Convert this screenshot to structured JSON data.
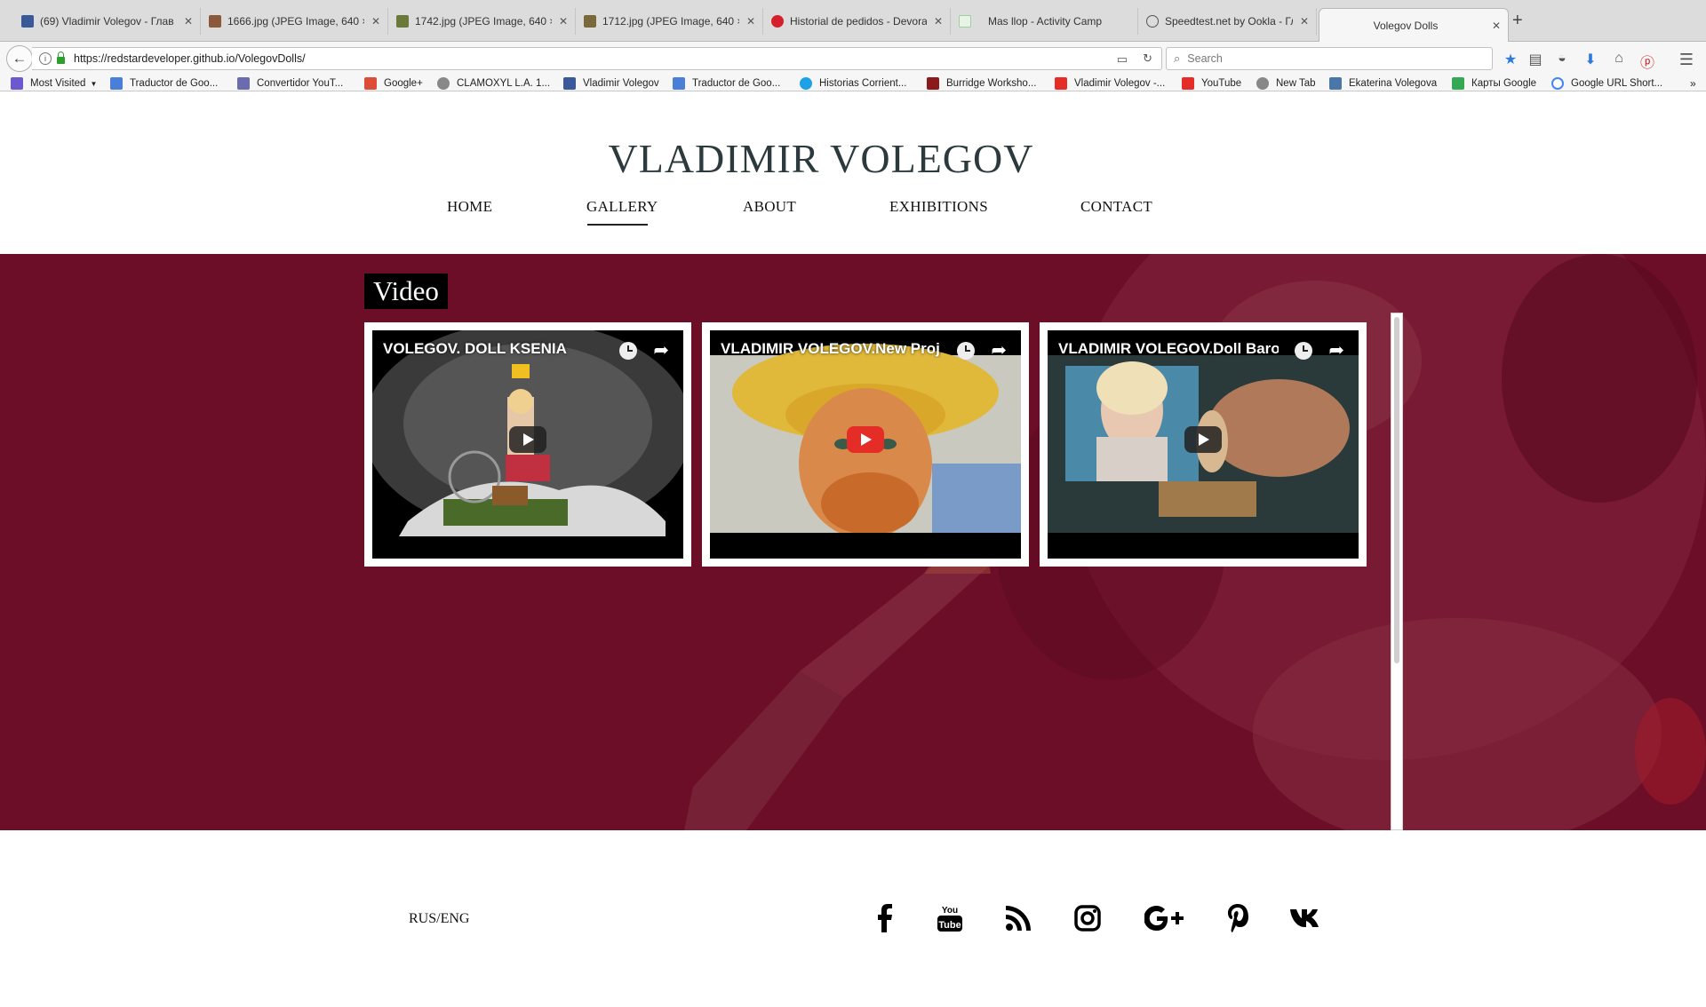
{
  "browser": {
    "tabs": [
      {
        "title": "(69) Vladimir Volegov - Глав",
        "icon": "facebook-icon",
        "color": "#3b5998"
      },
      {
        "title": "1666.jpg (JPEG Image, 640 ×",
        "icon": "image-thumb-icon",
        "color": "#8b5a3c"
      },
      {
        "title": "1742.jpg (JPEG Image, 640 ×",
        "icon": "image-thumb-icon",
        "color": "#6b7a3a"
      },
      {
        "title": "1712.jpg (JPEG Image, 640 ×",
        "icon": "image-thumb-icon",
        "color": "#7a6a3a"
      },
      {
        "title": "Historial de pedidos - Devora",
        "icon": "shop-icon",
        "color": "#d61f2c"
      },
      {
        "title": "Mas llop - Activity Camp",
        "icon": "page-icon",
        "color": "#9ccf9c"
      },
      {
        "title": "Speedtest.net by Ookla - Гло",
        "icon": "speedometer-icon",
        "color": "#555555"
      },
      {
        "title": "Volegov Dolls",
        "icon": "",
        "color": ""
      }
    ],
    "url": "https://redstardeveloper.github.io/VolegovDolls/",
    "search_placeholder": "Search",
    "bookmarks": [
      {
        "label": "Most Visited",
        "icon": "folder-icon",
        "color": "#6a5acd"
      },
      {
        "label": "Traductor de Goo...",
        "icon": "translate-icon",
        "color": "#4a7fd8"
      },
      {
        "label": "Convertidor YouT...",
        "icon": "converter-icon",
        "color": "#6b6bb0"
      },
      {
        "label": "Google+",
        "icon": "googleplus-icon",
        "color": "#dd4b39"
      },
      {
        "label": "CLAMOXYL L.A. 1...",
        "icon": "globe-icon",
        "color": "#666666"
      },
      {
        "label": "Vladimir Volegov",
        "icon": "facebook-icon",
        "color": "#3b5998"
      },
      {
        "label": "Traductor de Goo...",
        "icon": "translate-icon",
        "color": "#4a7fd8"
      },
      {
        "label": "Historias Corrient...",
        "icon": "chat-icon",
        "color": "#1ea1e6"
      },
      {
        "label": "Burridge Worksho...",
        "icon": "workshop-icon",
        "color": "#8b1a1a"
      },
      {
        "label": "Vladimir Volegov -...",
        "icon": "youtube-icon",
        "color": "#e52d27"
      },
      {
        "label": "YouTube",
        "icon": "youtube-icon",
        "color": "#e52d27"
      },
      {
        "label": "New Tab",
        "icon": "globe-icon",
        "color": "#666666"
      },
      {
        "label": "Ekaterina Volegova",
        "icon": "vk-icon",
        "color": "#4a76a8"
      },
      {
        "label": "Карты Google",
        "icon": "maps-icon",
        "color": "#34a853"
      },
      {
        "label": "Google URL Short...",
        "icon": "google-icon",
        "color": "#4285f4"
      }
    ]
  },
  "site": {
    "title": "VLADIMIR VOLEGOV",
    "nav": [
      "HOME",
      "GALLERY",
      "ABOUT",
      "EXHIBITIONS",
      "CONTACT"
    ],
    "active_nav": "GALLERY",
    "section_label": "Video",
    "videos": [
      {
        "title": "VOLEGOV. DOLL KSENIA"
      },
      {
        "title": "VLADIMIR VOLEGOV.New Proj..."
      },
      {
        "title": "VLADIMIR VOLEGOV.Doll Baro..."
      }
    ],
    "footer": {
      "lang": "RUS/ENG",
      "social": [
        "facebook-icon",
        "youtube-icon",
        "rss-icon",
        "instagram-icon",
        "googleplus-icon",
        "pinterest-icon",
        "vk-icon"
      ]
    },
    "colors": {
      "hero_bg": "#6d0e28",
      "title": "#2c3a3e"
    }
  }
}
